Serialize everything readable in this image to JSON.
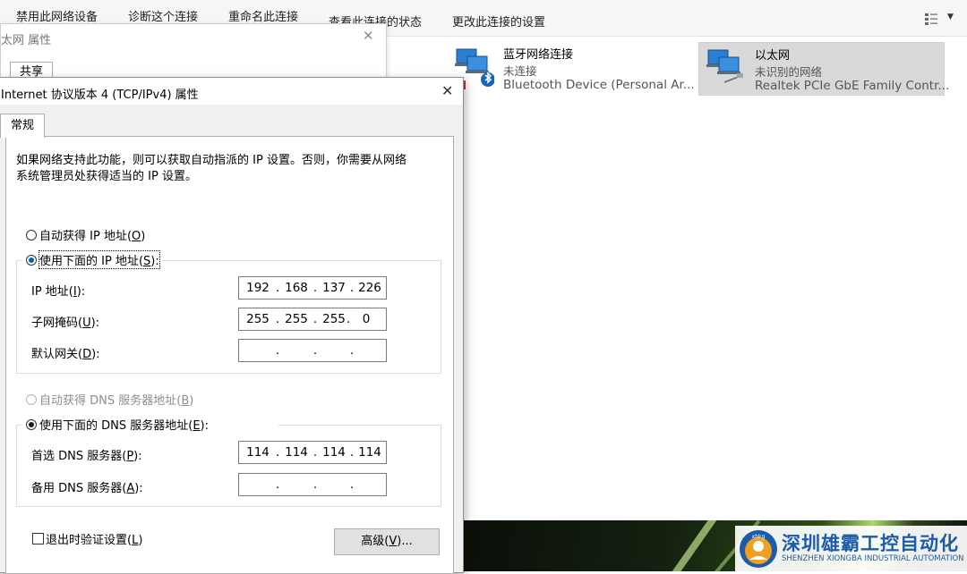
{
  "toolbar": {
    "items": [
      "禁用此网络设备",
      "诊断这个连接",
      "重命名此连接",
      "查看此连接的状态",
      "更改此连接的设置"
    ]
  },
  "connections": [
    {
      "name": "蓝牙网络连接",
      "status": "未连接",
      "device": "Bluetooth Device (Personal Ar...",
      "icon": "bluetooth-network-icon",
      "selected": false
    },
    {
      "name": "以太网",
      "status": "未识别的网络",
      "device": "Realtek PCIe GbE Family Contr...",
      "icon": "ethernet-network-icon",
      "selected": true
    }
  ],
  "props_dialog": {
    "title": "太网 属性",
    "tab": "共享"
  },
  "ipv4": {
    "title": "Internet 协议版本 4 (TCP/IPv4) 属性",
    "tab": "常规",
    "desc_line1": "如果网络支持此功能，则可以获取自动指派的 IP 设置。否则，你需要从网络",
    "desc_line2": "系统管理员处获得适当的 IP 设置。",
    "auto_ip": {
      "text": "自动获得 IP 地址(",
      "key": "O",
      "end": ")",
      "selected": false
    },
    "manual_ip": {
      "text": "使用下面的 IP 地址(",
      "key": "S",
      "end": "):",
      "selected": true
    },
    "ip_label": {
      "text": "IP 地址(",
      "key": "I",
      "end": "):"
    },
    "ip_value": [
      "192",
      "168",
      "137",
      "226"
    ],
    "mask_label": {
      "text": "子网掩码(",
      "key": "U",
      "end": "):"
    },
    "mask_value": [
      "255",
      "255",
      "255",
      "0"
    ],
    "gateway_label": {
      "text": "默认网关(",
      "key": "D",
      "end": "):"
    },
    "gateway_value": [
      "",
      "",
      "",
      ""
    ],
    "auto_dns": {
      "text": "自动获得 DNS 服务器地址(",
      "key": "B",
      "end": ")",
      "selected": false,
      "disabled": true
    },
    "manual_dns": {
      "text": "使用下面的 DNS 服务器地址(",
      "key": "E",
      "end": "):",
      "selected": true
    },
    "dns1_label": {
      "text": "首选 DNS 服务器(",
      "key": "P",
      "end": "):"
    },
    "dns1_value": [
      "114",
      "114",
      "114",
      "114"
    ],
    "dns2_label": {
      "text": "备用 DNS 服务器(",
      "key": "A",
      "end": "):"
    },
    "dns2_value": [
      "",
      "",
      "",
      ""
    ],
    "validate": {
      "text": "退出时验证设置(",
      "key": "L",
      "end": ")",
      "checked": false
    },
    "advanced": {
      "text": "高级(",
      "key": "V",
      "end": ")..."
    }
  },
  "watermark": {
    "cn": "深圳雄霸工控自动化",
    "en": "SHENZHEN XIONGBA INDUSTRIAL AUTOMATION"
  },
  "colors": {
    "radio_selected": "#0063b1",
    "accent_blue": "#1d5aa8"
  }
}
